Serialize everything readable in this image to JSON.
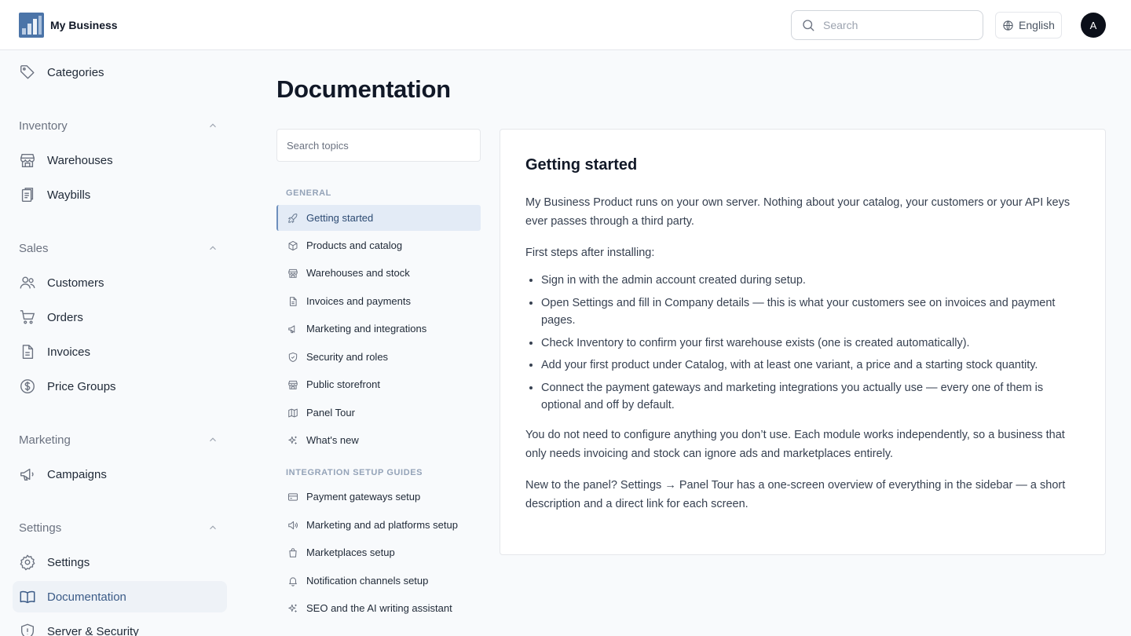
{
  "header": {
    "brand": "My Business",
    "search_placeholder": "Search",
    "language": "English",
    "avatar_initial": "A"
  },
  "sidebar": {
    "top_item": "Categories",
    "groups": [
      {
        "label": "Inventory",
        "items": [
          "Warehouses",
          "Waybills"
        ]
      },
      {
        "label": "Sales",
        "items": [
          "Customers",
          "Orders",
          "Invoices",
          "Price Groups"
        ]
      },
      {
        "label": "Marketing",
        "items": [
          "Campaigns"
        ]
      },
      {
        "label": "Settings",
        "items": [
          "Settings",
          "Documentation",
          "Server & Security"
        ]
      }
    ],
    "active_item": "Documentation",
    "accent_color": "#3b5b87"
  },
  "main": {
    "title": "Documentation",
    "topic_search_placeholder": "Search topics",
    "sections": [
      {
        "label": "GENERAL",
        "topics": [
          "Getting started",
          "Products and catalog",
          "Warehouses and stock",
          "Invoices and payments",
          "Marketing and integrations",
          "Security and roles",
          "Public storefront",
          "Panel Tour",
          "What's new"
        ]
      },
      {
        "label": "INTEGRATION SETUP GUIDES",
        "topics": [
          "Payment gateways setup",
          "Marketing and ad platforms setup",
          "Marketplaces setup",
          "Notification channels setup",
          "SEO and the AI writing assistant"
        ]
      }
    ],
    "active_topic": "Getting started",
    "article": {
      "title": "Getting started",
      "intro": "My Business Product runs on your own server. Nothing about your catalog, your customers or your API keys ever passes through a third party.",
      "steps_heading": "First steps after installing:",
      "steps": [
        "Sign in with the admin account created during setup.",
        "Open Settings and fill in Company details — this is what your customers see on invoices and payment pages.",
        "Check Inventory to confirm your first warehouse exists (one is created automatically).",
        "Add your first product under Catalog, with at least one variant, a price and a starting stock quantity.",
        "Connect the payment gateways and marketing integrations you actually use — every one of them is optional and off by default."
      ],
      "para2": "You do not need to configure anything you don’t use. Each module works independently, so a business that only needs invoicing and stock can ignore ads and marketplaces entirely.",
      "para3": "New to the panel? Settings → Panel Tour has a one-screen overview of everything in the sidebar — a short description and a direct link for each screen."
    }
  }
}
